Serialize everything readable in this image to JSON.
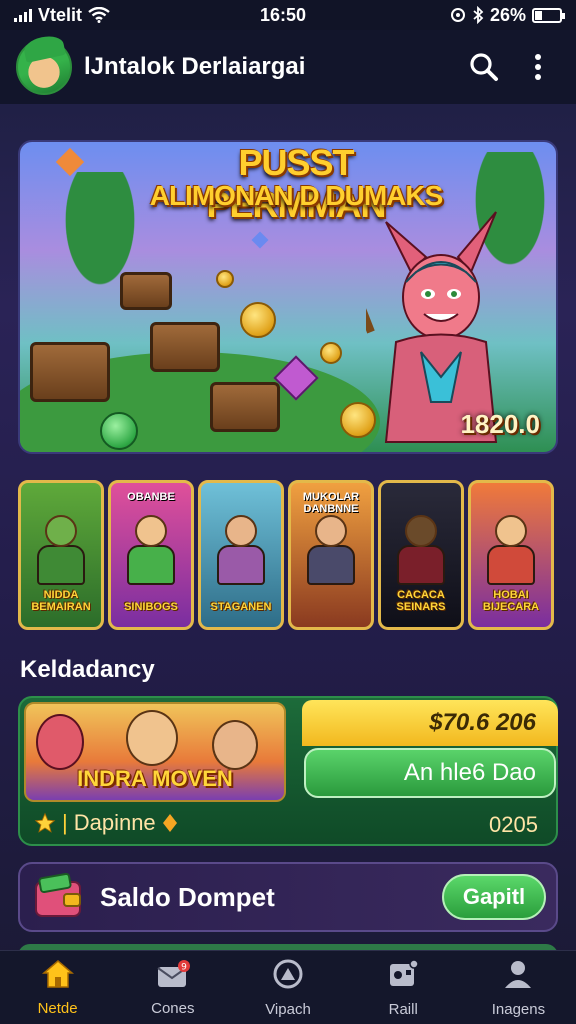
{
  "status_bar": {
    "carrier": "Vtelit",
    "time": "16:50",
    "battery": "26%",
    "battery_level": 0.26
  },
  "app_bar": {
    "title": "lJntalok Derlaiargai",
    "logo_icon": "green-hat-character-logo",
    "search_icon": "search-icon",
    "menu_icon": "more-vertical-icon"
  },
  "banner": {
    "title_line1": "PUSST PERMMAN",
    "title_line2": "ALIMONAN D DUMAKS",
    "amount": "1820.0"
  },
  "games": [
    {
      "top": "",
      "label": "NIDDA BEMAIRAN",
      "color_top": "#5fa93a",
      "color_bottom": "#2c6d2a",
      "skin": "#6fb04a",
      "body": "#3f8a35"
    },
    {
      "top": "OBANBE",
      "label": "SINIBOGS",
      "color_top": "#e0509a",
      "color_bottom": "#7a2ea0",
      "skin": "#f0c38e",
      "body": "#47b04a"
    },
    {
      "top": "",
      "label": "STAGANEN",
      "color_top": "#6fc0d8",
      "color_bottom": "#2e6d88",
      "skin": "#e8b58a",
      "body": "#9a5aa8"
    },
    {
      "top": "MUKOLAR DANBNNE",
      "label": "",
      "color_top": "#f0a040",
      "color_bottom": "#8a3a20",
      "skin": "#e8b58a",
      "body": "#4a4a6a"
    },
    {
      "top": "",
      "label": "CACACA SEINARS",
      "color_top": "#2a2a3a",
      "color_bottom": "#0f0f18",
      "skin": "#6a4a2a",
      "body": "#7a1f2a"
    },
    {
      "top": "",
      "label": "HOBAI BIJECARA",
      "color_top": "#f07a3a",
      "color_bottom": "#7a2ea0",
      "skin": "#f0c38e",
      "body": "#d04a3a"
    }
  ],
  "section": {
    "title": "Keldadancy"
  },
  "promo": {
    "image_title": "INDRA MOVEN",
    "amount": "$70.6 206",
    "button_label": "An hle6 Dao",
    "footer_left": "Dapinne",
    "footer_right": "0205"
  },
  "wallet": {
    "label": "Saldo Dompet",
    "button_label": "Gapitl",
    "icon": "wallet-icon"
  },
  "nav": [
    {
      "label": "Netde",
      "icon": "home-icon",
      "active": true
    },
    {
      "label": "Cones",
      "icon": "mail-icon",
      "active": false
    },
    {
      "label": "Vipach",
      "icon": "target-icon",
      "active": false
    },
    {
      "label": "Raill",
      "icon": "game-controller-icon",
      "active": false
    },
    {
      "label": "Inagens",
      "icon": "profile-icon",
      "active": false
    }
  ],
  "colors": {
    "accent": "#ffc21a",
    "green_button": "#3ab54c",
    "background": "#231d4a"
  }
}
